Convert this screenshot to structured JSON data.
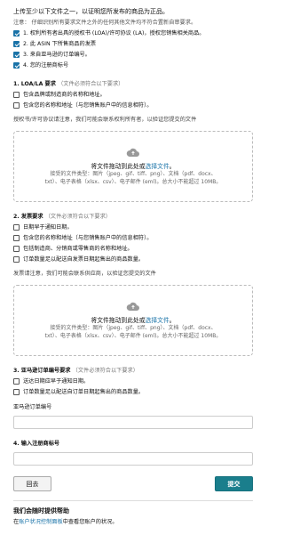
{
  "intro": "上传至少以下文件之一，以证明您所发布的商品为正品。",
  "note": "注意： 仔细识别所有要求文件之外的任何其他文件均不符合置新自审要求。",
  "doc_types": [
    {
      "label": "1. 权利所有者出具的授权书 (LOA)/许可协议 (LA)，授权您销售相关商品。",
      "checked": true
    },
    {
      "label": "2. 此 ASIN 下所售商品的发票",
      "checked": true
    },
    {
      "label": "3. 来自亚马逊的订单编号。",
      "checked": true
    },
    {
      "label": "4. 您的注册商标号",
      "checked": true
    }
  ],
  "section1": {
    "title": "1. LOA/LA 要求",
    "hint": "（文件必须符合以下要求）",
    "reqs": [
      "包含品牌或制造商的名称和地址。",
      "包含您的名称和地址（与您销售账户中的信息相符）。"
    ],
    "sub": "授权书/许可协议请注意，我们可能会联系权利所有者，以验证您提交的文件"
  },
  "upload": {
    "big_prefix": "将文件拖动到此处或",
    "big_link": "选择文件",
    "formats": "接受的文件类型：图片（jpeg、gif、tiff、png）、文档（pdf、docx、",
    "formats2": "txt）、电子表格（xlsx、csv）、电子邮件 (eml)。总大小不能超过 10MB。"
  },
  "section2": {
    "title": "2. 发票要求",
    "hint": "（文件必须符合以下要求）",
    "reqs": [
      "日期早于通知日期。",
      "包含您的名称和地址（与您销售账户中的信息相符）。",
      "包括制造商、分销商或零售商的名称和地址。",
      "订单数量足以配送自发票日期起售出的商品数量。"
    ],
    "sub": "发票请注意，我们可能会联系供应商，以验证您提交的文件"
  },
  "section3": {
    "title": "3. 亚马逊订单编号要求",
    "hint": "（文件必须符合以下要求）",
    "reqs": [
      "送达日期应早于通知日期。",
      "订单数量足以配送自订单日期起售出的商品数量。"
    ],
    "field_label": "亚马逊订单编号"
  },
  "section4": {
    "title": "4. 输入注册商标号"
  },
  "buttons": {
    "back": "回去",
    "submit": "提交"
  },
  "help": {
    "title": "我们会随时提供帮助",
    "text_prefix": "在",
    "link": "账户状况控制面板",
    "text_suffix": "中查看您账户的状况。"
  },
  "colors": {
    "accent": "#1a73a8",
    "submit": "#1a7e8c"
  }
}
